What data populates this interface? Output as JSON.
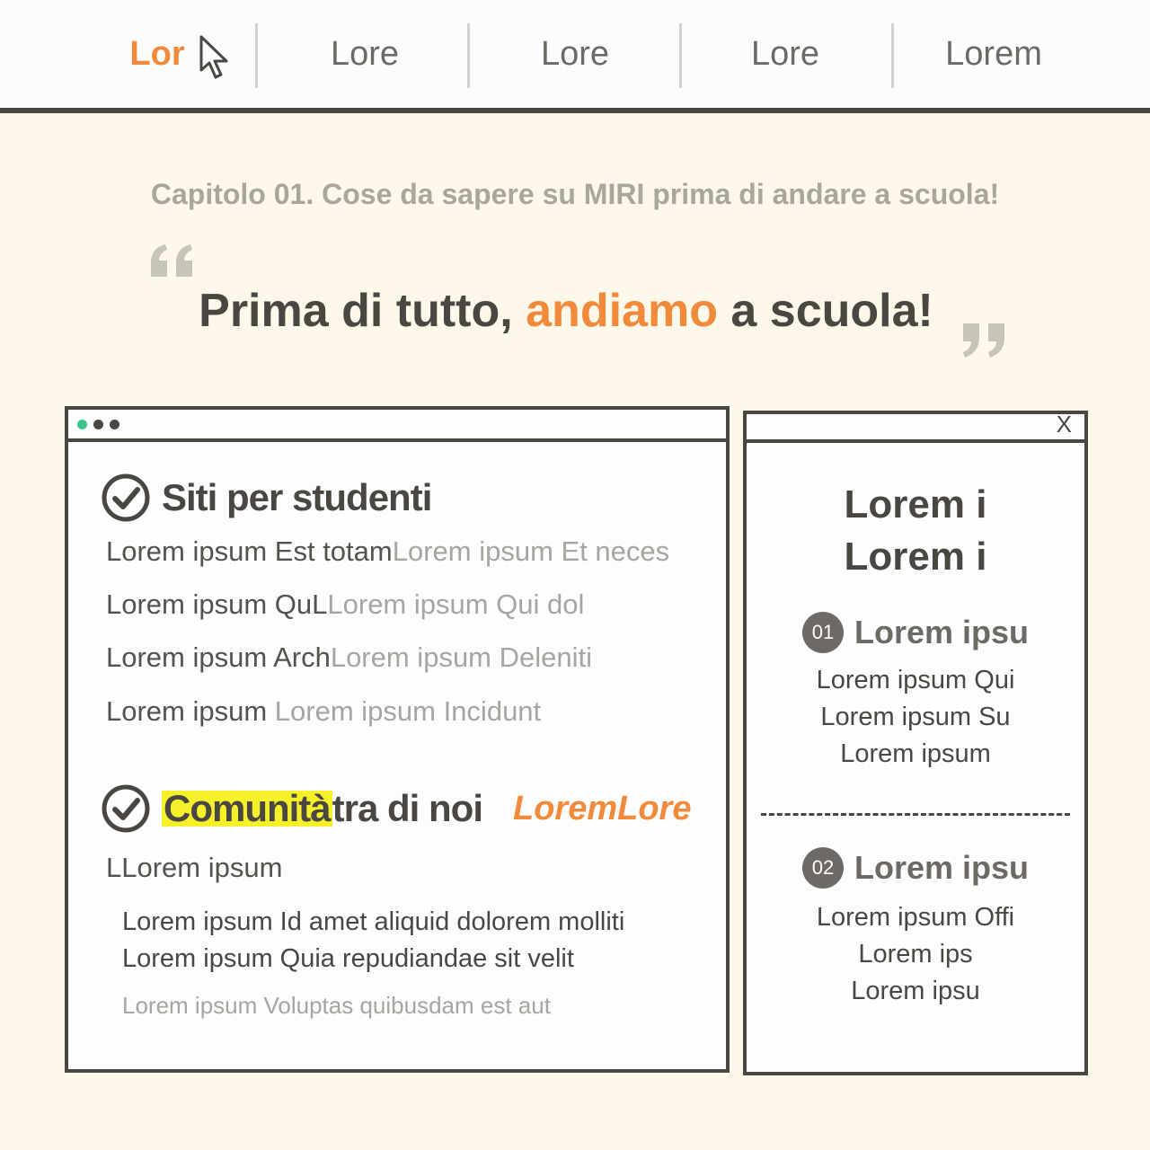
{
  "nav": {
    "tabs": [
      {
        "label": "Lor",
        "active": true
      },
      {
        "label": "Lore"
      },
      {
        "label": "Lore"
      },
      {
        "label": "Lore"
      },
      {
        "label": "Lorem"
      }
    ]
  },
  "chapter": "Capitolo 01. Cose da sapere su MIRI prima di andare a scuola!",
  "headline": {
    "part1": "Prima di tutto, ",
    "accent": "andiamo",
    "part2": " a scuola!"
  },
  "window": {
    "dot_colors": [
      "#3cc48f",
      "#4a4743",
      "#4a4743"
    ],
    "section1": {
      "title": "Siti per studenti",
      "rows": [
        {
          "dark": "Lorem ipsum Est totam",
          "light": "Lorem ipsum Et neces"
        },
        {
          "dark": "Lorem ipsum QuL",
          "light": "Lorem ipsum Qui dol"
        },
        {
          "dark": "Lorem ipsum Arch",
          "light": "Lorem ipsum Deleniti"
        },
        {
          "dark": "Lorem ipsum ",
          "light": "Lorem ipsum Incidunt"
        }
      ]
    },
    "section2": {
      "title_highlight": "Comunità",
      "title_rest": " tra di noi",
      "tag": "LoremLore",
      "subtitle": "LLorem ipsum",
      "lines": [
        "Lorem ipsum Id amet aliquid dolorem molliti",
        "Lorem ipsum Quia repudiandae sit velit"
      ],
      "note": "Lorem ipsum Voluptas quibusdam est aut"
    }
  },
  "popup": {
    "close": "X",
    "title_lines": [
      "Lorem i",
      "Lorem i"
    ],
    "items": [
      {
        "badge": "01",
        "heading": "Lorem ipsu",
        "lines": [
          "Lorem ipsum Qui",
          "Lorem ipsum Su",
          "Lorem ipsum"
        ]
      },
      {
        "badge": "02",
        "heading": "Lorem ipsu",
        "lines": [
          "Lorem ipsum Offi",
          "Lorem ips",
          "Lorem ipsu"
        ]
      }
    ]
  },
  "colors": {
    "accent": "#f28a3c",
    "highlight": "#f6f02a",
    "dark": "#4a4743",
    "background": "#fdf8ea"
  }
}
